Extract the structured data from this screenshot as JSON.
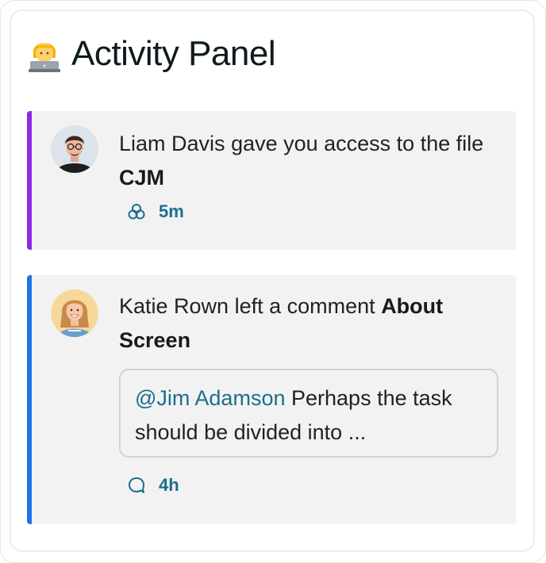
{
  "panel": {
    "title": "Activity Panel",
    "title_icon": "technologist-emoji"
  },
  "activities": [
    {
      "user": "Liam Davis",
      "action": "gave you access to the file",
      "target": "CJM",
      "meta_icon": "share-icon",
      "time": "5m",
      "accent_color": "#8a2be2"
    },
    {
      "user": "Katie Rown",
      "action": "left a comment",
      "target": "About Screen",
      "mention": "@Jim Adamson",
      "comment": "Perhaps the task should be divided into ...",
      "meta_icon": "comment-icon",
      "time": "4h",
      "accent_color": "#1e73e8"
    }
  ],
  "colors": {
    "card_bg": "#f2f2f2",
    "meta_text": "#1c6e8c",
    "title_text": "#0f1a1c"
  }
}
